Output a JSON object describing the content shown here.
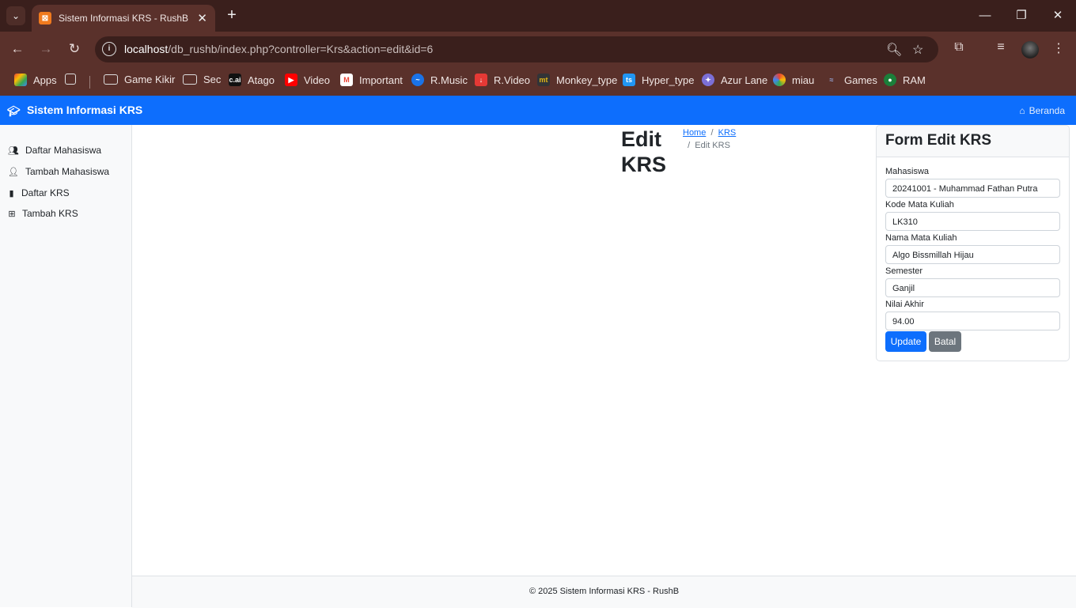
{
  "browser": {
    "tab_title": "Sistem Informasi KRS - RushB",
    "url_host": "localhost",
    "url_rest": "/db_rushb/index.php?controller=Krs&action=edit&id=6",
    "bookmarks": [
      "Apps",
      "Game Kikir",
      "Sec",
      "Atago",
      "Video",
      "Important",
      "R.Music",
      "R.Video",
      "Monkey_type",
      "Hyper_type",
      "Azur Lane",
      "miau",
      "Games",
      "RAM"
    ]
  },
  "app": {
    "brand": "Sistem Informasi KRS",
    "nav_home": "Beranda",
    "sidebar": [
      "Daftar Mahasiswa",
      "Tambah Mahasiswa",
      "Daftar KRS",
      "Tambah KRS"
    ],
    "page_title": "Edit KRS",
    "breadcrumb": [
      "Home",
      "KRS",
      "Edit KRS"
    ],
    "form": {
      "title": "Form Edit KRS",
      "fields": [
        {
          "label": "Mahasiswa",
          "value": "20241001 - Muhammad Fathan Putra"
        },
        {
          "label": "Kode Mata Kuliah",
          "value": "LK310"
        },
        {
          "label": "Nama Mata Kuliah",
          "value": "Algo Bissmillah Hijau"
        },
        {
          "label": "Semester",
          "value": "Ganjil"
        },
        {
          "label": "Nilai Akhir",
          "value": "94.00"
        }
      ],
      "update_label": "Update",
      "cancel_label": "Batal"
    },
    "footer": "© 2025 Sistem Informasi KRS - RushB"
  }
}
